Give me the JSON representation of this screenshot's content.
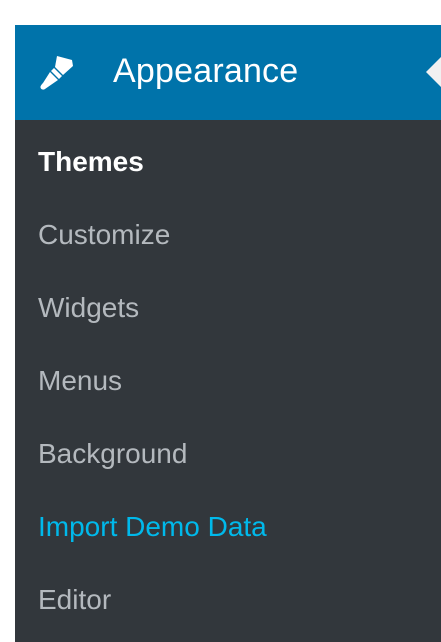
{
  "menu": {
    "title": "Appearance",
    "icon": "paintbrush-icon",
    "colors": {
      "header_bg": "#0073aa",
      "menu_bg": "#32373c",
      "item_text": "#b4b9be",
      "current_text": "#ffffff",
      "highlight_text": "#00b9eb"
    },
    "items": [
      {
        "label": "Themes",
        "state": "current"
      },
      {
        "label": "Customize",
        "state": "normal"
      },
      {
        "label": "Widgets",
        "state": "normal"
      },
      {
        "label": "Menus",
        "state": "normal"
      },
      {
        "label": "Background",
        "state": "normal"
      },
      {
        "label": "Import Demo Data",
        "state": "highlight"
      },
      {
        "label": "Editor",
        "state": "normal"
      }
    ]
  }
}
